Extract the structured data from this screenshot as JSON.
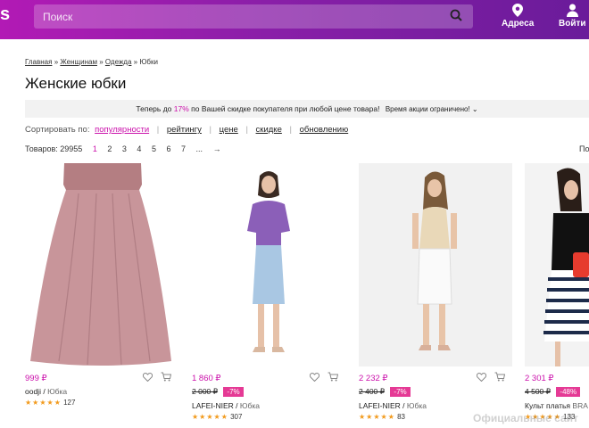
{
  "header": {
    "logo": "s",
    "search_placeholder": "Поиск",
    "address_label": "Адреса",
    "login_label": "Войти",
    "colors": {
      "accent": "#cb11ab",
      "header_start": "#b21ab5",
      "header_end": "#6a1b9a"
    }
  },
  "breadcrumb": {
    "items": [
      "Главная",
      "Женщинам",
      "Одежда"
    ],
    "separator": "»",
    "current": "Юбки"
  },
  "page_title": "Женские юбки",
  "promo": {
    "text_before": "Теперь до",
    "percent": "17%",
    "text_after": "по Вашей скидке покупателя при любой цене товара!",
    "limited": "Время акции ограничено!"
  },
  "sort": {
    "label": "Сортировать по:",
    "options": [
      "популярности",
      "рейтингу",
      "цене",
      "скидке",
      "обновлению"
    ]
  },
  "pager": {
    "count_label": "Товаров: 29955",
    "pages": [
      "1",
      "2",
      "3",
      "4",
      "5",
      "6",
      "7",
      "...",
      "→"
    ],
    "right_clip": "По"
  },
  "products": [
    {
      "price": "999 ₽",
      "old_price": "",
      "discount": "",
      "brand": "oodji",
      "category": "Юбка",
      "stars": "★★★★★",
      "reviews": "127"
    },
    {
      "price": "1 860 ₽",
      "old_price": "2 000 ₽",
      "discount": "-7%",
      "brand": "LAFEI-NIER",
      "category": "Юбка",
      "stars": "★★★★★",
      "reviews": "307"
    },
    {
      "price": "2 232 ₽",
      "old_price": "2 400 ₽",
      "discount": "-7%",
      "brand": "LAFEI-NIER",
      "category": "Юбка",
      "stars": "★★★★★",
      "reviews": "83"
    },
    {
      "price": "2 301 ₽",
      "old_price": "4 500 ₽",
      "discount": "-48%",
      "brand": "Культ платья",
      "category": "BRA",
      "stars": "★★★★★",
      "reviews": "133"
    }
  ],
  "watermark": "Официальные сайт"
}
